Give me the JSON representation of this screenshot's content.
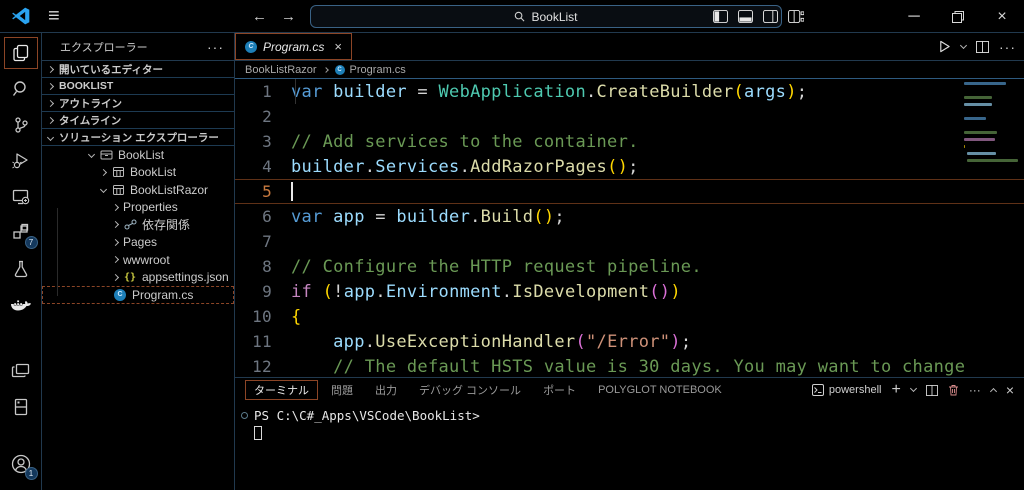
{
  "colors": {
    "accent_orange": "#8c4526",
    "focus_orange": "#c97a3f",
    "border_blue": "#21394e",
    "breadcrumb_border": "#2e5a7f",
    "logo_blue": "#2aa3f0",
    "badge_blue": "#14385c",
    "csharp_icon_blue": "#1d7fb8",
    "json_yellow": "#cbcb41"
  },
  "titlebar": {
    "search_value": "BookList",
    "back_arrow": "←",
    "forward_arrow": "→",
    "hamburger": "≡",
    "minimize": "─",
    "close": "×"
  },
  "activity_bar": {
    "items": [
      {
        "name": "explorer",
        "active": true
      },
      {
        "name": "search"
      },
      {
        "name": "source-control"
      },
      {
        "name": "run-and-debug"
      },
      {
        "name": "remote-explorer"
      },
      {
        "name": "extensions",
        "badge": "7"
      },
      {
        "name": "testing"
      },
      {
        "name": "docker"
      },
      {
        "name": "live-preview"
      },
      {
        "name": "polyglot-notebook"
      },
      {
        "name": "accounts",
        "badge": "1"
      }
    ],
    "extensions_badge": "7",
    "accounts_badge": "1"
  },
  "sidebar": {
    "title": "エクスプローラー",
    "more_dots": "···",
    "sections": [
      {
        "label": "開いているエディター",
        "expanded": false
      },
      {
        "label": "BOOKLIST",
        "expanded": false
      },
      {
        "label": "アウトライン",
        "expanded": false
      },
      {
        "label": "タイムライン",
        "expanded": false
      },
      {
        "label": "ソリューション エクスプローラー",
        "expanded": true
      }
    ],
    "tree": [
      {
        "label": "BookList",
        "depth": 0,
        "chevron": "down",
        "icon": "solution"
      },
      {
        "label": "BookList",
        "depth": 1,
        "chevron": "right",
        "icon": "project"
      },
      {
        "label": "BookListRazor",
        "depth": 1,
        "chevron": "down",
        "icon": "project"
      },
      {
        "label": "Properties",
        "depth": 2,
        "chevron": "right",
        "icon": "none"
      },
      {
        "label": "依存関係",
        "depth": 2,
        "chevron": "right",
        "icon": "dependencies"
      },
      {
        "label": "Pages",
        "depth": 2,
        "chevron": "right",
        "icon": "none"
      },
      {
        "label": "wwwroot",
        "depth": 2,
        "chevron": "right",
        "icon": "none"
      },
      {
        "label": "appsettings.json",
        "depth": 2,
        "chevron": "right",
        "icon": "json"
      },
      {
        "label": "Program.cs",
        "depth": 2,
        "chevron": "none",
        "icon": "csharp",
        "selected": true
      }
    ]
  },
  "editor": {
    "tab": {
      "label": "Program.cs",
      "close": "×"
    },
    "breadcrumbs": [
      "BookListRazor",
      "Program.cs"
    ],
    "current_line": 5,
    "syntax": {
      "kw": "#569cd6",
      "kw2": "#c586c0",
      "var": "#9cdcfe",
      "cls": "#4ec9b0",
      "fn": "#dcdcaa",
      "com": "#6a9955",
      "str": "#ce9178",
      "pun": "#d4d4d4",
      "b1": "#ffd700",
      "b2": "#da70d6"
    },
    "lines": [
      {
        "n": 1,
        "tokens": [
          [
            "var ",
            "kw"
          ],
          [
            "builder ",
            "var"
          ],
          [
            "= ",
            "pun"
          ],
          [
            "WebApplication",
            "cls"
          ],
          [
            ".",
            "pun"
          ],
          [
            "CreateBuilder",
            "fn"
          ],
          [
            "(",
            "b1"
          ],
          [
            "args",
            "var"
          ],
          [
            ")",
            "b1"
          ],
          [
            ";",
            "pun"
          ]
        ]
      },
      {
        "n": 2,
        "tokens": []
      },
      {
        "n": 3,
        "tokens": [
          [
            "// Add services to the container.",
            "com"
          ]
        ]
      },
      {
        "n": 4,
        "tokens": [
          [
            "builder",
            "var"
          ],
          [
            ".",
            "pun"
          ],
          [
            "Services",
            "var"
          ],
          [
            ".",
            "pun"
          ],
          [
            "AddRazorPages",
            "fn"
          ],
          [
            "()",
            "b1"
          ],
          [
            ";",
            "pun"
          ]
        ]
      },
      {
        "n": 5,
        "tokens": [],
        "current": true
      },
      {
        "n": 6,
        "tokens": [
          [
            "var ",
            "kw"
          ],
          [
            "app ",
            "var"
          ],
          [
            "= ",
            "pun"
          ],
          [
            "builder",
            "var"
          ],
          [
            ".",
            "pun"
          ],
          [
            "Build",
            "fn"
          ],
          [
            "()",
            "b1"
          ],
          [
            ";",
            "pun"
          ]
        ]
      },
      {
        "n": 7,
        "tokens": []
      },
      {
        "n": 8,
        "tokens": [
          [
            "// Configure the HTTP request pipeline.",
            "com"
          ]
        ]
      },
      {
        "n": 9,
        "tokens": [
          [
            "if ",
            "kw2"
          ],
          [
            "(",
            "b1"
          ],
          [
            "!",
            "pun"
          ],
          [
            "app",
            "var"
          ],
          [
            ".",
            "pun"
          ],
          [
            "Environment",
            "var"
          ],
          [
            ".",
            "pun"
          ],
          [
            "IsDevelopment",
            "fn"
          ],
          [
            "()",
            "b2"
          ],
          [
            ")",
            "b1"
          ]
        ]
      },
      {
        "n": 10,
        "tokens": [
          [
            "{",
            "b1"
          ]
        ]
      },
      {
        "n": 11,
        "guide": true,
        "tokens": [
          [
            "    ",
            "pun"
          ],
          [
            "app",
            "var"
          ],
          [
            ".",
            "pun"
          ],
          [
            "UseExceptionHandler",
            "fn"
          ],
          [
            "(",
            "b2"
          ],
          [
            "\"/Error\"",
            "str"
          ],
          [
            ")",
            "b2"
          ],
          [
            ";",
            "pun"
          ]
        ]
      },
      {
        "n": 12,
        "guide": true,
        "tokens": [
          [
            "    ",
            "pun"
          ],
          [
            "// The default HSTS value is 30 days. You may want to change",
            "com"
          ]
        ]
      }
    ]
  },
  "panel": {
    "tabs": [
      {
        "label": "ターミナル",
        "active": true
      },
      {
        "label": "問題"
      },
      {
        "label": "出力"
      },
      {
        "label": "デバッグ コンソール"
      },
      {
        "label": "ポート"
      },
      {
        "label": "POLYGLOT NOTEBOOK"
      }
    ],
    "shell_label": "powershell",
    "more_dots": "···",
    "terminal_prompt": "PS C:\\C#_Apps\\VSCode\\BookList>"
  }
}
